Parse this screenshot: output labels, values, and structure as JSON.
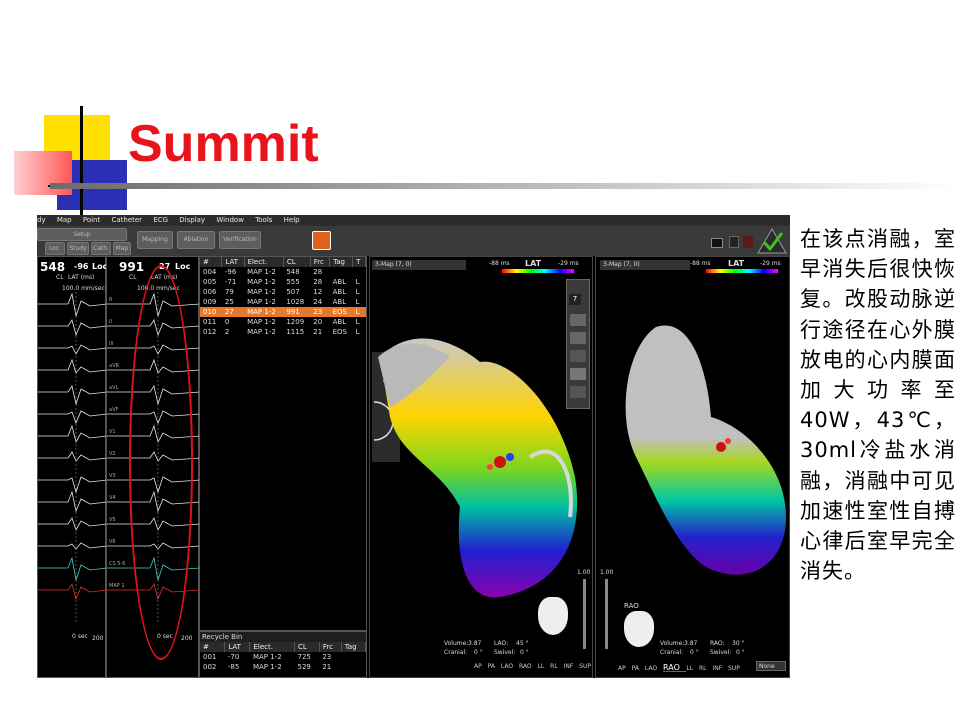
{
  "slide": {
    "title": "Summit",
    "notes": "在该点消融，室早消失后很快恢复。改股动脉逆行途径在心外膜放电的心内膜面加大功率至40W，43℃，30ml冷盐水消融，消融中可见加速性室性自搏心律后室早完全消失。"
  },
  "colors": {
    "title": "#e8141b",
    "deco_yellow": "#ffe000",
    "deco_red": "#ff5757",
    "deco_blue": "#2b2fb6",
    "selected_row": "#e67a2c"
  },
  "app": {
    "menu": [
      "dy",
      "Map",
      "Point",
      "Catheter",
      "ECG",
      "Display",
      "Window",
      "Tools",
      "Help"
    ],
    "toolbar": {
      "setup": "Setup",
      "loc": "Loc.",
      "study": "Study",
      "cath": "Cath.",
      "map": "Map",
      "mapping": "Mapping",
      "ablation": "Ablation",
      "verification": "Verification"
    },
    "signals_left": {
      "value": "548",
      "lat": "-96",
      "loc": "Loc",
      "cl_label": "CL",
      "lat_label": "LAT (ms)",
      "speed": "100.0 mm/sec",
      "bottom_time": "0 sec",
      "bottom_range": "200"
    },
    "signals_right": {
      "value": "991",
      "lat": "27",
      "loc": "Loc",
      "cl_label": "CL",
      "lat_label": "LAT (ms)",
      "speed": "100.0 mm/sec",
      "bottom_time": "0 sec",
      "bottom_range": "200"
    },
    "channel_labels": [
      "R",
      "II",
      "III",
      "aVR",
      "aVL",
      "aVF",
      "V1",
      "V2",
      "V3",
      "V4",
      "V5",
      "V6",
      "CS 5-6",
      "MAP 1",
      "MAP 1",
      "-200"
    ],
    "points_table": {
      "headers": [
        "#",
        "LAT",
        "Elect.",
        "CL",
        "Frc",
        "Tag",
        "T"
      ],
      "rows": [
        [
          "004",
          "-96",
          "MAP 1-2",
          "548",
          "28",
          "",
          ""
        ],
        [
          "005",
          "-71",
          "MAP 1-2",
          "555",
          "28",
          "ABL",
          "L"
        ],
        [
          "006",
          "79",
          "MAP 1-2",
          "507",
          "12",
          "ABL",
          "L"
        ],
        [
          "009",
          "25",
          "MAP 1-2",
          "1028",
          "24",
          "ABL",
          "L"
        ],
        [
          "010",
          "27",
          "MAP 1-2",
          "991",
          "23",
          "EOS",
          "L"
        ],
        [
          "011",
          "0",
          "MAP 1-2",
          "1209",
          "20",
          "ABL",
          "L"
        ],
        [
          "012",
          "2",
          "MAP 1-2",
          "1115",
          "21",
          "EOS",
          "L"
        ]
      ],
      "selected_index": 4
    },
    "recycle_bin": {
      "title": "Recycle Bin",
      "headers": [
        "#",
        "LAT",
        "Elect.",
        "CL",
        "Frc",
        "Tag"
      ],
      "rows": [
        [
          "001",
          "-70",
          "MAP 1-2",
          "725",
          "23",
          ""
        ],
        [
          "002",
          "-85",
          "MAP 1-2",
          "529",
          "21",
          ""
        ]
      ]
    },
    "map_left": {
      "dropdown": "3-Map (7, 0)",
      "lat_min": "-88 ms",
      "lat_label": "LAT",
      "lat_max": "-29 ms",
      "scale_top": "1.00",
      "angle": "23",
      "volume_label": "Volume:",
      "volume": "3.87",
      "lao_label": "LAO:",
      "lao": "45 °",
      "cranial_label": "Cranial:",
      "cranial": "0 °",
      "swivel_label": "Swivel:",
      "swivel": "0 °",
      "views": [
        "AP",
        "PA",
        "LAO",
        "RAO",
        "LL",
        "RL",
        "INF",
        "SUP"
      ],
      "tool_number": "7"
    },
    "map_right": {
      "dropdown": "3-Map (7, 0)",
      "lat_min": "-88 ms",
      "lat_label": "LAT",
      "lat_max": "-29 ms",
      "scale_top": "1.00",
      "orientation": "RAO",
      "volume_label": "Volume:",
      "volume": "3.87",
      "rao_label": "RAO:",
      "rao": "30 °",
      "cranial_label": "Cranial:",
      "cranial": "0 °",
      "swivel_label": "Swivel:",
      "swivel": "0 °",
      "views": [
        "AP",
        "PA",
        "LAO",
        "RAO",
        "LL",
        "RL",
        "INF",
        "SUP"
      ],
      "active_view": "RAO",
      "none_select": "None"
    }
  }
}
